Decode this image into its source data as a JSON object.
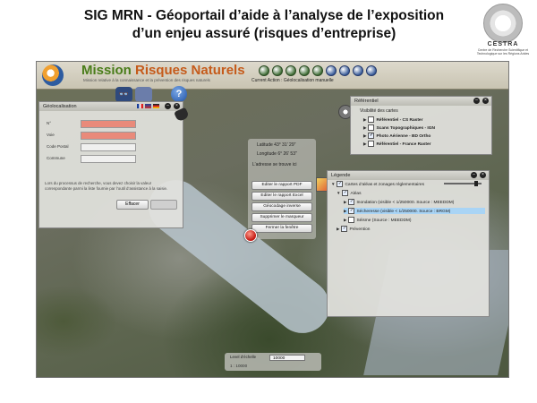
{
  "slide": {
    "title_line1": "SIG MRN - Géoportail d’aide à l’analyse de l’exposition",
    "title_line2": "d’un enjeu assuré (risques d’entreprise)"
  },
  "logo": {
    "name": "CESTRA",
    "subtitle": "Centre de Recherche Scientifique et Technologique sur les Régions Arides"
  },
  "app": {
    "brand_part1": "Mission",
    "brand_part2": "Risques Naturels",
    "tagline": "Mission relative à la connaissance et la prévention des risques naturels",
    "current_action": "Current Action : Géolocalisation manuelle",
    "owl_button_label": "👓",
    "help_button_label": "?"
  },
  "geolocation": {
    "title": "Géolocalisation",
    "fields": [
      {
        "label": "N°",
        "state": "required"
      },
      {
        "label": "Voie",
        "state": "required"
      },
      {
        "label": "Code Postal",
        "state": "optional"
      },
      {
        "label": "Commune",
        "state": "optional"
      }
    ],
    "help_text": "Lors du processus de recherche, vous devez choisir la valeur correspondante parmi la liste fournie par l’outil d’assistance à la saisie.",
    "button_clear": "Effacer"
  },
  "coordinates": {
    "latitude": "Latitude 43° 31' 29''",
    "longitude": "Longitude 6° 26' 53''",
    "address_prompt": "L’adresse se trouve ici"
  },
  "actions": [
    "Editer le rapport PDF",
    "Editer le rapport Excel",
    "Géocodage inverse",
    "Supprimer le marqueur",
    "Fermer la fenêtre"
  ],
  "referentiel": {
    "title": "Référentiel",
    "subtitle": "Visibilité des cartes",
    "items": [
      "Référentiel - CS Raster",
      "Scans Topographiques - IGN",
      "Photo Aérienne - BD Ortho",
      "Référentiel - France Raster"
    ]
  },
  "legend": {
    "title": "Légende",
    "root": "Cartes d’aléas et zonages réglementaires",
    "items": [
      {
        "label": "Aléas",
        "checked": true,
        "level": 1,
        "selected": false
      },
      {
        "label": "Inondation (visible < 1/250000. Source : MEEDDM)",
        "checked": true,
        "level": 2,
        "selected": false
      },
      {
        "label": "Sécheresse (visible < 1/250000. Source : BRGM)",
        "checked": true,
        "level": 2,
        "selected": true
      },
      {
        "label": "Séisme (Source : MEEDDM)",
        "checked": false,
        "level": 2,
        "selected": false
      },
      {
        "label": "Prévention",
        "checked": true,
        "level": 1,
        "selected": false
      }
    ]
  },
  "zoom": {
    "label": "Level d’échelle",
    "value": "10000",
    "range": "1 : 10000"
  },
  "colors": {
    "brand_green": "#4a7d1a",
    "brand_orange": "#c55b1b",
    "required_field": "#e98a7a",
    "selection": "#a9d4f5",
    "marker": "#c0140e"
  }
}
